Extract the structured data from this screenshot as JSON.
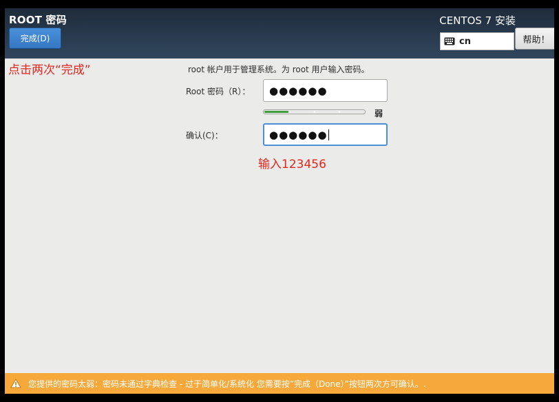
{
  "header": {
    "title": "ROOT 密码",
    "done_label": "完成(D)",
    "install_title": "CENTOS 7 安装",
    "keyboard_layout": "cn",
    "help_label": "帮助！"
  },
  "annotations": {
    "click_done": "点击两次“完成”",
    "input_hint": "输入123456"
  },
  "form": {
    "intro": "root 帐户用于管理系统。为 root 用户输入密码。",
    "root_label": "Root 密码（R）：",
    "root_value": "●●●●●●",
    "strength_label": "弱",
    "strength_level": 0.25,
    "confirm_label": "确认(C)：",
    "confirm_value": "●●●●●●"
  },
  "warning": {
    "text": "您提供的密码太弱：密码未通过字典检查 - 过于简单化/系统化 您需要按”完成（Done）”按钮两次方可确认。."
  },
  "colors": {
    "header_bg": "#2a3c50",
    "done_button": "#3a7fc9",
    "annotation": "#e3261e",
    "strength_fill": "#3e9e3a",
    "warning_bg": "#f6a93a"
  },
  "icons": {
    "keyboard": "keyboard-icon",
    "warning": "warning-icon"
  }
}
